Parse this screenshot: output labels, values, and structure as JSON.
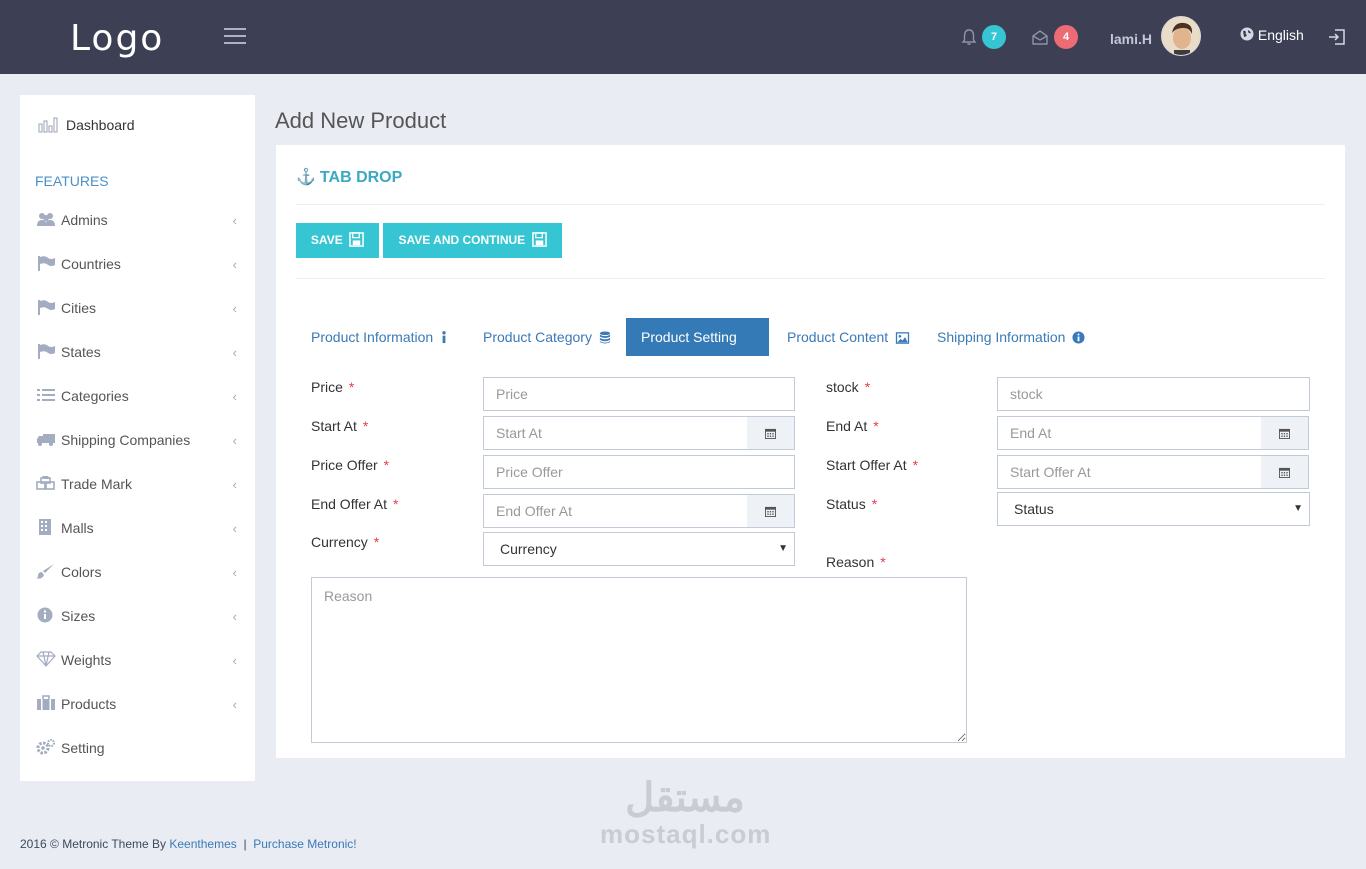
{
  "header": {
    "logo": "Logo",
    "notifications_count": "7",
    "messages_count": "4",
    "username": "lami.H",
    "language": "English",
    "colors": {
      "bar": "#3d4054",
      "notif_badge": "#36c6d3",
      "msg_badge": "#ed6b75"
    }
  },
  "sidebar": {
    "dashboard": "Dashboard",
    "heading": "FEATURES",
    "items": [
      {
        "label": "Admins",
        "icon": "users-icon"
      },
      {
        "label": "Countries",
        "icon": "flag-icon"
      },
      {
        "label": "Cities",
        "icon": "flag-icon"
      },
      {
        "label": "States",
        "icon": "flag-icon"
      },
      {
        "label": "Categories",
        "icon": "list-icon"
      },
      {
        "label": "Shipping Companies",
        "icon": "truck-icon"
      },
      {
        "label": "Trade Mark",
        "icon": "cubes-icon"
      },
      {
        "label": "Malls",
        "icon": "building-icon"
      },
      {
        "label": "Colors",
        "icon": "brush-icon"
      },
      {
        "label": "Sizes",
        "icon": "info-icon"
      },
      {
        "label": "Weights",
        "icon": "diamond-icon"
      },
      {
        "label": "Products",
        "icon": "briefcase-icon"
      },
      {
        "label": "Setting",
        "icon": "cogs-icon"
      }
    ]
  },
  "main": {
    "page_title": "Add New Product",
    "portlet_title": "TAB DROP",
    "save_label": "SAVE",
    "save_continue_label": "SAVE AND CONTINUE",
    "tabs": [
      {
        "label": "Product Information",
        "icon": "info-icon"
      },
      {
        "label": "Product Category",
        "icon": "database-icon"
      },
      {
        "label": "Product Setting",
        "icon": "gear-icon",
        "active": true
      },
      {
        "label": "Product Content",
        "icon": "image-icon"
      },
      {
        "label": "Shipping Information",
        "icon": "info-circle-icon"
      }
    ],
    "form": {
      "price": {
        "label": "Price",
        "placeholder": "Price"
      },
      "stock": {
        "label": "stock",
        "placeholder": "stock"
      },
      "start_at": {
        "label": "Start At",
        "placeholder": "Start At"
      },
      "end_at": {
        "label": "End At",
        "placeholder": "End At"
      },
      "price_offer": {
        "label": "Price Offer",
        "placeholder": "Price Offer"
      },
      "start_offer_at": {
        "label": "Start Offer At",
        "placeholder": "Start Offer At"
      },
      "end_offer_at": {
        "label": "End Offer At",
        "placeholder": "End Offer At"
      },
      "status": {
        "label": "Status",
        "value": "Status"
      },
      "currency": {
        "label": "Currency",
        "value": "Currency"
      },
      "reason": {
        "label": "Reason",
        "placeholder": "Reason"
      },
      "required_mark": "*"
    }
  },
  "watermark": {
    "arabic": "مستقل",
    "latin": "mostaql.com"
  },
  "footer": {
    "text": "2016 © Metronic Theme By",
    "author_link": "Keenthemes",
    "separator": "|",
    "purchase_link": "Purchase Metronic!"
  }
}
